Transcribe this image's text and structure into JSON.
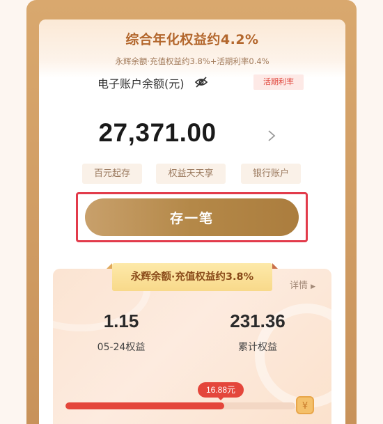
{
  "header": {
    "title": "综合年化权益约4.2%",
    "subtitle": "永辉余额·充值权益约3.8%+活期利率0.4%"
  },
  "account": {
    "balance_label": "电子账户余额(元)",
    "balance_amount": "27,371.00",
    "rate_tag": "活期利率",
    "hide_icon": "eye-off-icon"
  },
  "features": [
    "百元起存",
    "权益天天享",
    "银行账户"
  ],
  "deposit_button": {
    "label": "存一笔"
  },
  "earnings_card": {
    "ribbon": "永辉余额·充值权益约3.8%",
    "details_link": "详情",
    "stats": [
      {
        "value": "1.15",
        "label": "05-24权益"
      },
      {
        "value": "231.36",
        "label": "累计权益"
      }
    ]
  },
  "progress": {
    "bubble_text": "16.88元",
    "fraction": 0.69
  },
  "colors": {
    "brand_gold": "#b48848",
    "accent_red": "#e4463b",
    "title_brown": "#b3672d"
  }
}
